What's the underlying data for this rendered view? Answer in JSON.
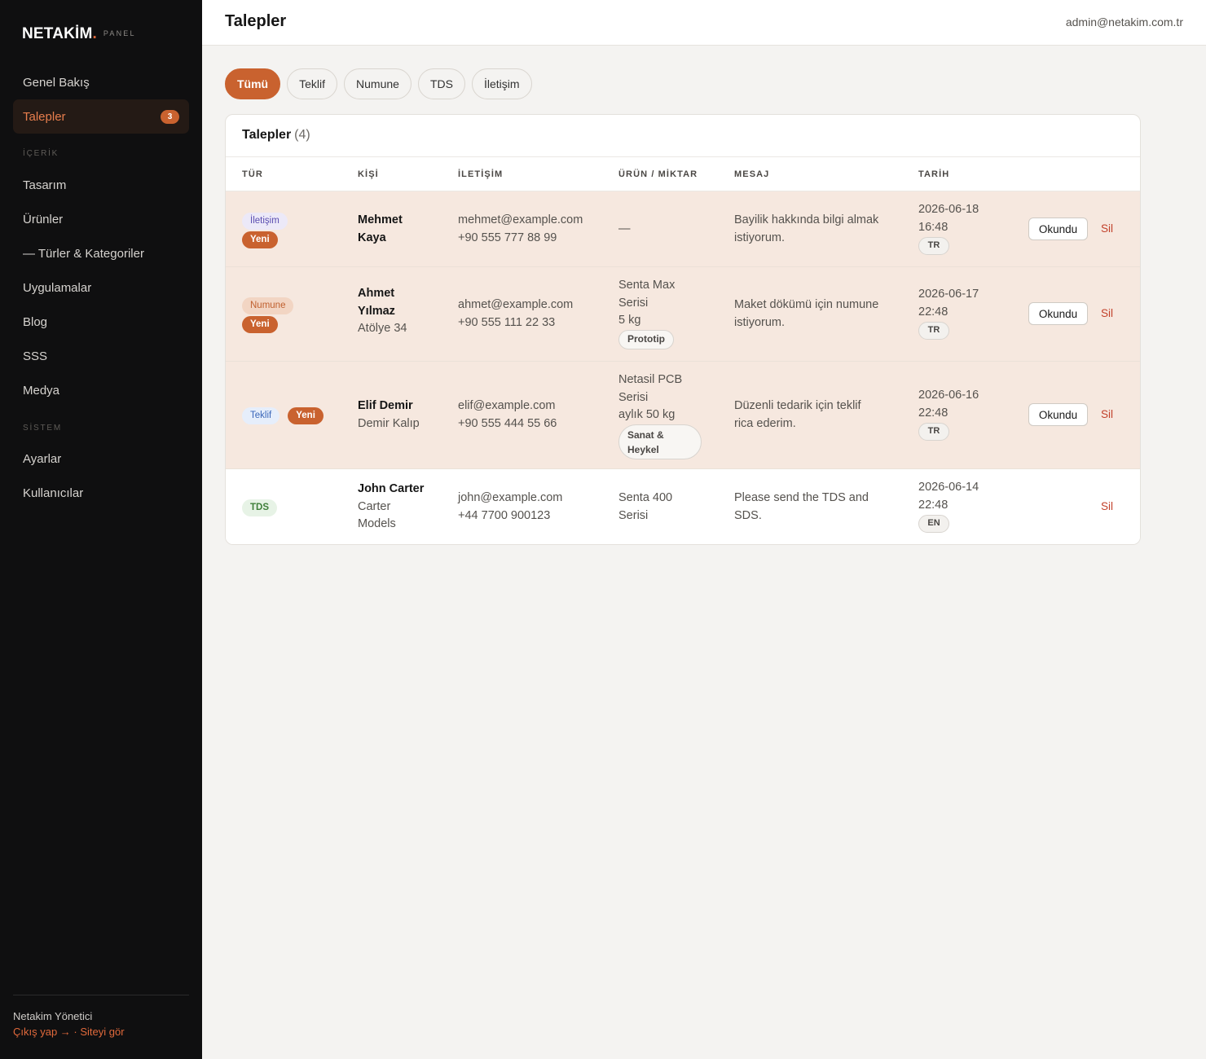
{
  "brand": {
    "name": "NETAKİM",
    "dot": ".",
    "suffix": "PANEL"
  },
  "sidebar": {
    "items": [
      {
        "label": "Genel Bakış"
      },
      {
        "label": "Talepler",
        "badge": "3",
        "active": true
      }
    ],
    "section_icerik": "İÇERİK",
    "icerik_items": [
      {
        "label": "Tasarım"
      },
      {
        "label": "Ürünler"
      },
      {
        "label": "— Türler & Kategoriler"
      },
      {
        "label": "Uygulamalar"
      },
      {
        "label": "Blog"
      },
      {
        "label": "SSS"
      },
      {
        "label": "Medya"
      }
    ],
    "section_sistem": "SİSTEM",
    "sistem_items": [
      {
        "label": "Ayarlar"
      },
      {
        "label": "Kullanıcılar"
      }
    ],
    "user": "Netakim Yönetici",
    "logout": "Çıkış yap →",
    "sep": " · ",
    "site": "Siteyi gör"
  },
  "header": {
    "title": "Talepler",
    "user": "admin@netakim.com.tr"
  },
  "filters": [
    "Tümü",
    "Teklif",
    "Numune",
    "TDS",
    "İletişim"
  ],
  "table": {
    "title": "Talepler",
    "count": "(4)",
    "columns": [
      "TÜR",
      "KİŞİ",
      "İLETİŞİM",
      "ÜRÜN / MİKTAR",
      "MESAJ",
      "TARİH"
    ],
    "rows": [
      {
        "type": "İletişim",
        "new": "Yeni",
        "name_1": "Mehmet",
        "name_2": "Kaya",
        "company": "",
        "email": "mehmet@example.com",
        "phone": "+90 555 777 88 99",
        "product_1": "—",
        "product_2": "",
        "qty": "",
        "chip": "",
        "msg_1": "Bayilik hakkında bilgi almak",
        "msg_2": "istiyorum.",
        "date": "2026-06-18",
        "time": "16:48",
        "lang": "TR",
        "read_btn": "Okundu",
        "del_btn": "Sil"
      },
      {
        "type": "Numune",
        "new": "Yeni",
        "name_1": "Ahmet",
        "name_2": "Yılmaz",
        "company": "Atölye 34",
        "email": "ahmet@example.com",
        "phone": "+90 555 111 22 33",
        "product_1": "Senta Max",
        "product_2": "Serisi",
        "qty": "5 kg",
        "chip": "Prototip",
        "msg_1": "Maket dökümü için numune",
        "msg_2": "istiyorum.",
        "date": "2026-06-17",
        "time": "22:48",
        "lang": "TR",
        "read_btn": "Okundu",
        "del_btn": "Sil"
      },
      {
        "type": "Teklif",
        "new": "Yeni",
        "name_1": "Elif Demir",
        "name_2": "",
        "company": "Demir Kalıp",
        "email": "elif@example.com",
        "phone": "+90 555 444 55 66",
        "product_1": "Netasil PCB",
        "product_2": "Serisi",
        "qty": "aylık 50 kg",
        "chip_1": "Sanat &",
        "chip_2": "Heykel",
        "msg_1": "Düzenli tedarik için teklif",
        "msg_2": "rica ederim.",
        "date": "2026-06-16",
        "time": "22:48",
        "lang": "TR",
        "read_btn": "Okundu",
        "del_btn": "Sil"
      },
      {
        "type": "TDS",
        "name_1": "John Carter",
        "company_1": "Carter",
        "company_2": "Models",
        "email": "john@example.com",
        "phone": "+44 7700 900123",
        "product_1": "Senta 400",
        "product_2": "Serisi",
        "msg_1": "Please send the TDS and",
        "msg_2": "SDS.",
        "date": "2026-06-14",
        "time": "22:48",
        "lang": "EN",
        "del_btn": "Sil"
      }
    ]
  },
  "colors": {
    "accent": "#c9622f",
    "sidebar_bg": "#0f0f10",
    "unread_row": "#f6e8df",
    "danger": "#c2412b"
  }
}
